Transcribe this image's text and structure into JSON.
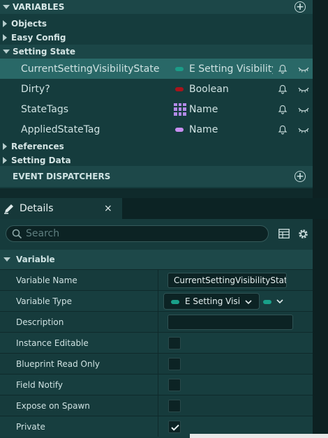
{
  "variables_panel": {
    "title": "VARIABLES",
    "categories": {
      "objects": "Objects",
      "easy_config": "Easy Config",
      "setting_state": "Setting State",
      "references": "References",
      "setting_data": "Setting Data"
    },
    "items": [
      {
        "name": "CurrentSettingVisibilityState",
        "type": "E Setting Visibility State",
        "pin_color": "#1a9c87"
      },
      {
        "name": "Dirty?",
        "type": "Boolean",
        "pin_color": "#a8141c"
      },
      {
        "name": "StateTags",
        "type": "Name",
        "pin_color": "#b28ae6"
      },
      {
        "name": "AppliedStateTag",
        "type": "Name",
        "pin_color": "#c78ef0"
      }
    ],
    "event_dispatchers": "EVENT DISPATCHERS"
  },
  "details": {
    "tab_label": "Details",
    "close_glyph": "×",
    "search_placeholder": "Search",
    "section": "Variable",
    "rows": {
      "variable_name": {
        "label": "Variable Name",
        "value": "CurrentSettingVisibilityState"
      },
      "variable_type": {
        "label": "Variable Type",
        "value": "E Setting Visibility State"
      },
      "description": {
        "label": "Description",
        "value": ""
      },
      "instance_editable": {
        "label": "Instance Editable",
        "checked": false
      },
      "blueprint_read_only": {
        "label": "Blueprint Read Only",
        "checked": false
      },
      "field_notify": {
        "label": "Field Notify",
        "checked": false
      },
      "expose_on_spawn": {
        "label": "Expose on Spawn",
        "checked": false
      },
      "private": {
        "label": "Private",
        "checked": true
      }
    }
  },
  "colors": {
    "accent_teal": "#1a9c87",
    "selected_row": "#296867",
    "panel_bg": "#153c3d"
  }
}
